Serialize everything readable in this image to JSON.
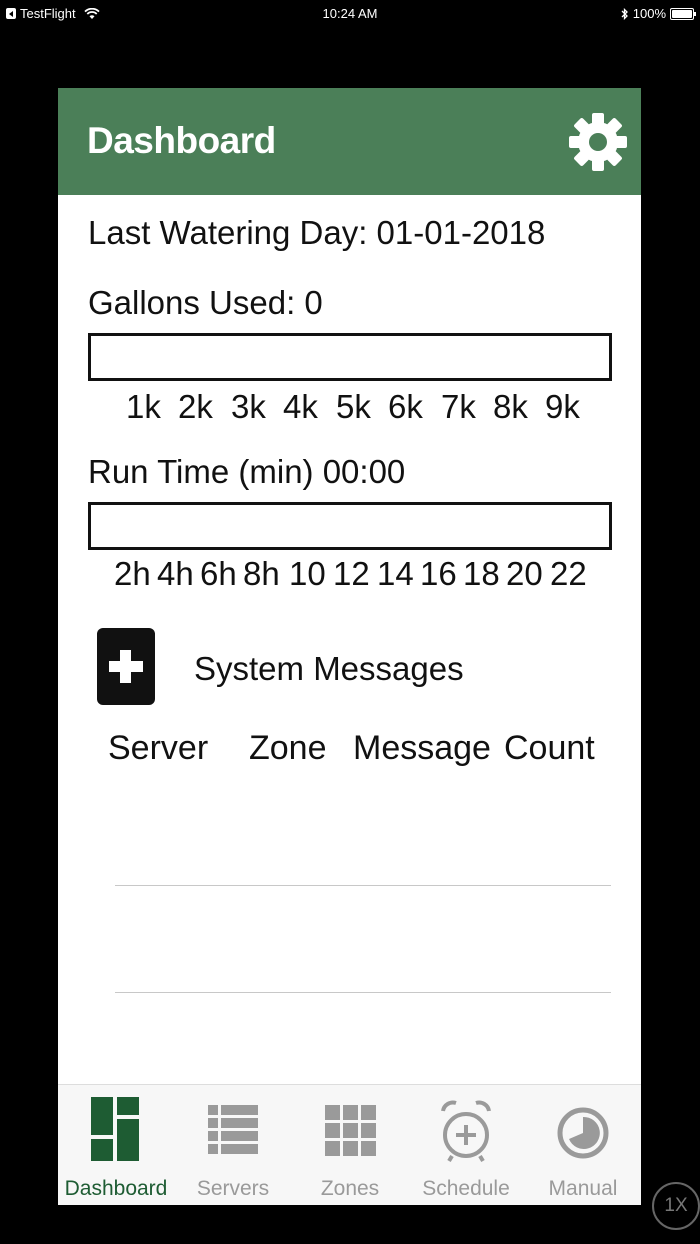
{
  "status_bar": {
    "carrier": "TestFlight",
    "time": "10:24 AM",
    "battery": "100%"
  },
  "header": {
    "title": "Dashboard"
  },
  "dashboard": {
    "last_watering": "Last Watering Day: 01-01-2018",
    "gallons_used": "Gallons Used: 0",
    "gallons_progress": 0,
    "gallons_ticks": [
      "1k",
      "2k",
      "3k",
      "4k",
      "5k",
      "6k",
      "7k",
      "8k",
      "9k"
    ],
    "run_time": "Run Time (min) 00:00",
    "run_time_progress": 0,
    "run_time_ticks": [
      "2h",
      "4h",
      "6h",
      "8h",
      "10",
      "12",
      "14",
      "16",
      "18",
      "20",
      "22"
    ]
  },
  "messages": {
    "title": "System Messages",
    "columns": [
      "Server",
      "Zone",
      "Message",
      "Count"
    ]
  },
  "tabs": [
    {
      "label": "Dashboard",
      "icon": "dashboard-icon",
      "active": true
    },
    {
      "label": "Servers",
      "icon": "servers-icon",
      "active": false
    },
    {
      "label": "Zones",
      "icon": "zones-icon",
      "active": false
    },
    {
      "label": "Schedule",
      "icon": "schedule-icon",
      "active": false
    },
    {
      "label": "Manual",
      "icon": "manual-icon",
      "active": false
    }
  ],
  "zoom_badge": "1X",
  "colors": {
    "header_green": "#4b7f58",
    "tab_active": "#1e5c33",
    "tab_inactive": "#9a9a9a"
  }
}
